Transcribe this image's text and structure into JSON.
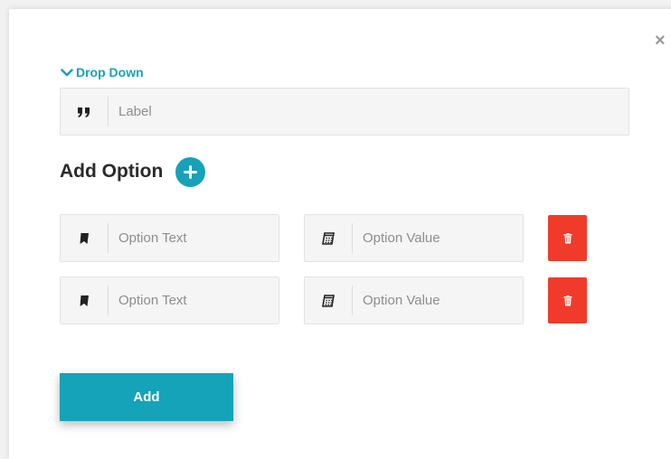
{
  "dialog": {
    "close_glyph": "×",
    "section_toggle_label": "Drop Down",
    "label_field": {
      "placeholder": "Label",
      "icon": "quote-icon"
    },
    "add_option_heading": "Add Option",
    "options": [
      {
        "text_placeholder": "Option Text",
        "value_placeholder": "Option Value",
        "text_icon": "bookmark-icon",
        "value_icon": "calculator-icon"
      },
      {
        "text_placeholder": "Option Text",
        "value_placeholder": "Option Value",
        "text_icon": "bookmark-icon",
        "value_icon": "calculator-icon"
      }
    ],
    "submit_label": "Add"
  },
  "colors": {
    "accent": "#17a2b8",
    "danger": "#f03b2a",
    "field_bg": "#f5f5f5"
  }
}
